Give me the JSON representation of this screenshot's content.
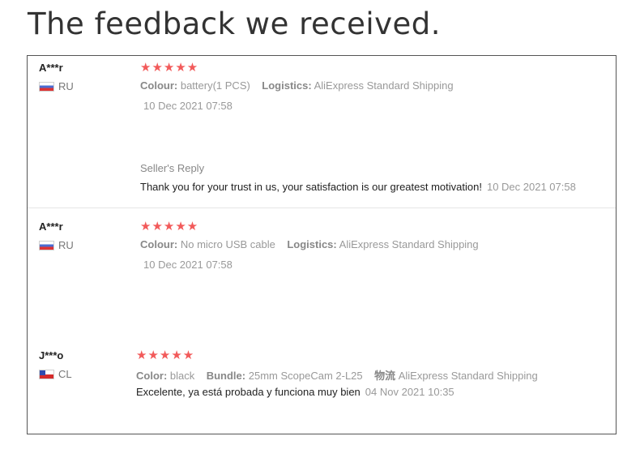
{
  "page": {
    "title": "The feedback we received."
  },
  "reviews": [
    {
      "user": "A***r",
      "country": "RU",
      "stars": "★★★★★",
      "attr1_label": "Colour:",
      "attr1_value": "battery(1 PCS)",
      "attr2_label": "Logistics:",
      "attr2_value": "AliExpress Standard Shipping",
      "date": "10 Dec 2021 07:58",
      "reply": {
        "title": "Seller's Reply",
        "text": "Thank you for your trust in us, your satisfaction is our greatest motivation!",
        "date": "10 Dec 2021 07:58"
      }
    },
    {
      "user": "A***r",
      "country": "RU",
      "stars": "★★★★★",
      "attr1_label": "Colour:",
      "attr1_value": "No micro USB cable",
      "attr2_label": "Logistics:",
      "attr2_value": "AliExpress Standard Shipping",
      "date": "10 Dec 2021 07:58"
    },
    {
      "user": "J***o",
      "country": "CL",
      "stars": "★★★★★",
      "attr1_label": "Color:",
      "attr1_value": "black",
      "attr2_label": "Bundle:",
      "attr2_value": "25mm ScopeCam 2-L25",
      "attr3_label": "物流",
      "attr3_value": "AliExpress Standard Shipping",
      "text": "Excelente, ya está probada y funciona muy bien",
      "date": "04 Nov 2021 10:35"
    }
  ],
  "colors": {
    "stars": "#f25a5a",
    "border": "#555555",
    "muted": "#999999"
  }
}
